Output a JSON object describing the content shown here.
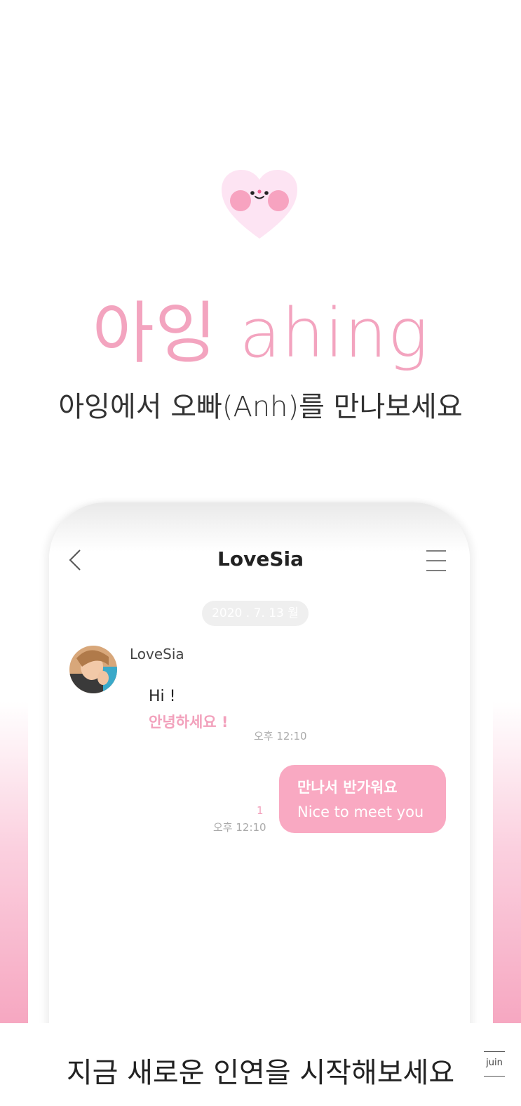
{
  "brand": {
    "title": "아잉 ahing",
    "tagline": "아잉에서 오빠(Anh)를 만나보세요"
  },
  "chat": {
    "title": "LoveSia",
    "date_label": "2020 . 7. 13 월",
    "incoming": {
      "sender": "LoveSia",
      "text_en": "Hi !",
      "text_ko": "안녕하세요 !",
      "time": "오후 12:10"
    },
    "outgoing": {
      "text_ko": "만나서 반가워요",
      "text_en": "Nice to meet you",
      "unread_count": "1",
      "time": "오후 12:10"
    }
  },
  "footer": {
    "text": "지금 새로운 인연을 시작해보세요",
    "logo_text": "juin"
  },
  "colors": {
    "accent_pink": "#f3a4bf",
    "bubble_pink": "#f9a9c2"
  },
  "icons": [
    "heart-mascot-icon",
    "chevron-left-icon",
    "hamburger-menu-icon"
  ]
}
